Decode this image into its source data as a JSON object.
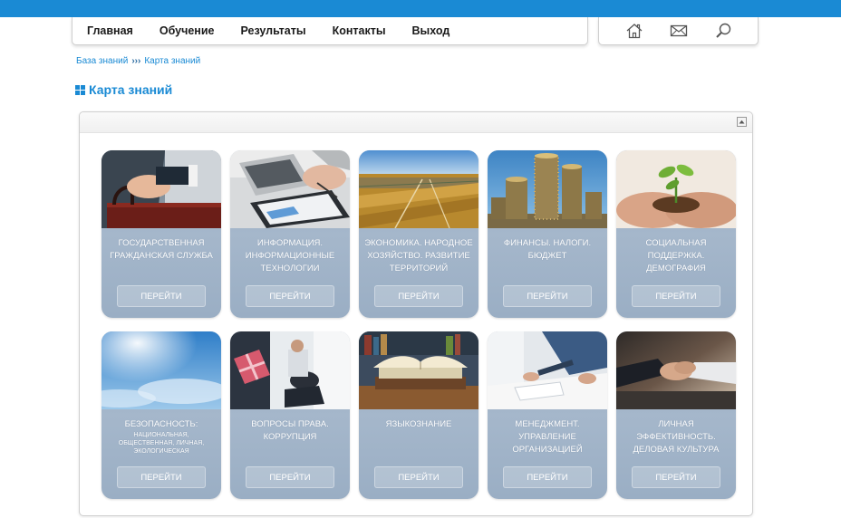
{
  "nav": {
    "items": [
      "Главная",
      "Обучение",
      "Результаты",
      "Контакты",
      "Выход"
    ]
  },
  "tools": {
    "icons": [
      "home-icon",
      "mail-icon",
      "search-icon"
    ]
  },
  "breadcrumb": {
    "root": "База знаний",
    "separator": "›››",
    "current": "Карта знаний"
  },
  "page": {
    "title": "Карта знаний"
  },
  "colors": {
    "accent": "#1a8ad4",
    "card": "#a5b7cb"
  },
  "cards": [
    {
      "title": "Государственная гражданская служба",
      "sub": "",
      "button": "Перейти",
      "image": "briefcase-photo"
    },
    {
      "title": "Информация. Информационные технологии",
      "sub": "",
      "button": "Перейти",
      "image": "laptop-tablet-photo"
    },
    {
      "title": "Экономика. Народное хозяйство. Развитие территорий",
      "sub": "",
      "button": "Перейти",
      "image": "aerial-fields-photo"
    },
    {
      "title": "Финансы. Налоги. Бюджет",
      "sub": "",
      "button": "Перейти",
      "image": "coins-photo"
    },
    {
      "title": "Социальная поддержка. Демография",
      "sub": "",
      "button": "Перейти",
      "image": "sprout-hands-photo"
    },
    {
      "title": "Безопасность:",
      "sub": "национальная, общественная, личная, экологическая",
      "button": "Перейти",
      "image": "sky-photo"
    },
    {
      "title": "Вопросы права. Коррупция",
      "sub": "",
      "button": "Перейти",
      "image": "gift-bribe-photo"
    },
    {
      "title": "Языкознание",
      "sub": "",
      "button": "Перейти",
      "image": "books-photo"
    },
    {
      "title": "Менеджмент. Управление организацией",
      "sub": "",
      "button": "Перейти",
      "image": "office-desk-photo"
    },
    {
      "title": "Личная эффективность. Деловая культура",
      "sub": "",
      "button": "Перейти",
      "image": "handshake-photo"
    }
  ]
}
